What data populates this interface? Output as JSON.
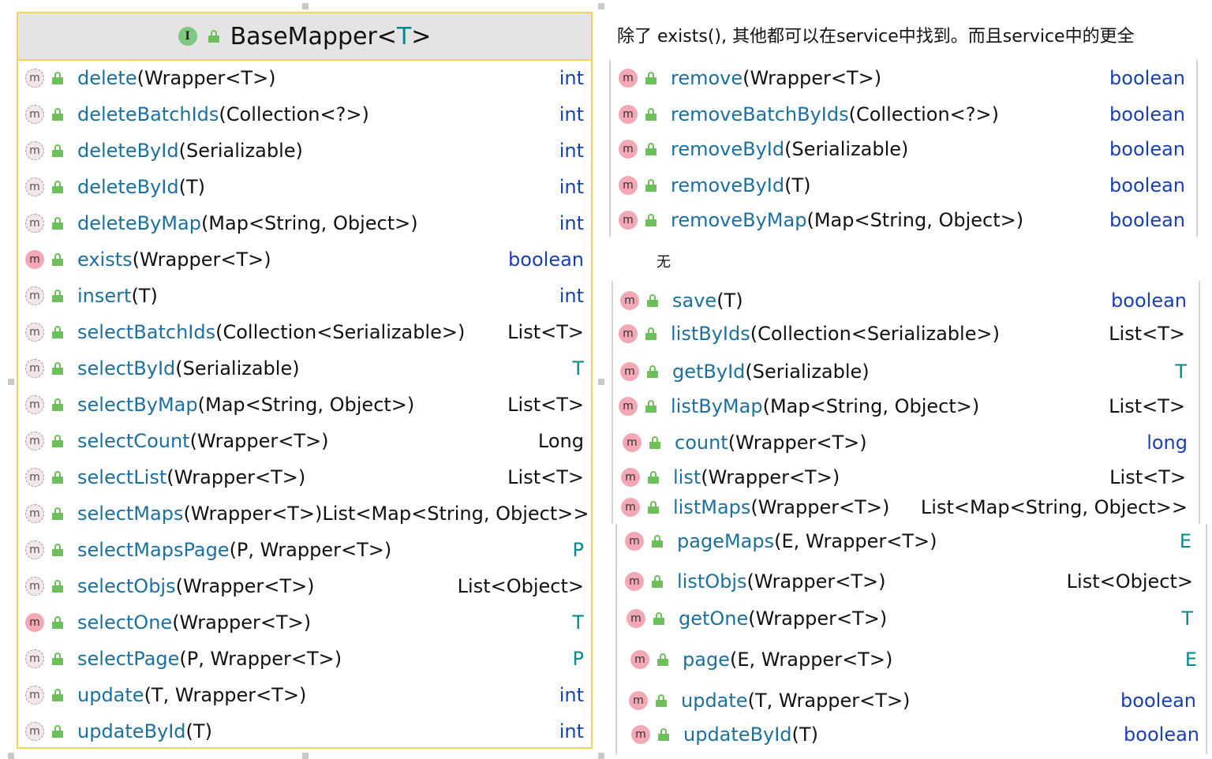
{
  "class": {
    "name": "BaseMapper",
    "type_param": "T",
    "iface_letter": "I"
  },
  "left_methods": [
    {
      "name": "delete",
      "params": "(Wrapper<T>)",
      "ret": "int",
      "style": "kw",
      "icon": "dim"
    },
    {
      "name": "deleteBatchIds",
      "params": "(Collection<?>)",
      "ret": "int",
      "style": "kw",
      "icon": "dim"
    },
    {
      "name": "deleteById",
      "params": "(Serializable)",
      "ret": "int",
      "style": "kw",
      "icon": "dim"
    },
    {
      "name": "deleteById",
      "params": "(T)",
      "ret": "int",
      "style": "kw",
      "icon": "dim"
    },
    {
      "name": "deleteByMap",
      "params": "(Map<String, Object>)",
      "ret": "int",
      "style": "kw",
      "icon": "dim"
    },
    {
      "name": "exists",
      "params": "(Wrapper<T>)",
      "ret": "boolean",
      "style": "kw",
      "icon": "full"
    },
    {
      "name": "insert",
      "params": "(T)",
      "ret": "int",
      "style": "kw",
      "icon": "dim"
    },
    {
      "name": "selectBatchIds",
      "params": "(Collection<Serializable>)",
      "ret": "List<T>",
      "style": "plain",
      "icon": "dim"
    },
    {
      "name": "selectById",
      "params": "(Serializable)",
      "ret": "T",
      "style": "tp",
      "icon": "dim"
    },
    {
      "name": "selectByMap",
      "params": "(Map<String, Object>)",
      "ret": "List<T>",
      "style": "plain",
      "icon": "dim"
    },
    {
      "name": "selectCount",
      "params": "(Wrapper<T>)",
      "ret": "Long",
      "style": "plain",
      "icon": "dim"
    },
    {
      "name": "selectList",
      "params": "(Wrapper<T>)",
      "ret": "List<T>",
      "style": "plain",
      "icon": "dim"
    },
    {
      "name": "selectMaps",
      "params": "(Wrapper<T>)",
      "ret": "List<Map<String, Object>>",
      "style": "plain",
      "icon": "dim"
    },
    {
      "name": "selectMapsPage",
      "params": "(P, Wrapper<T>)",
      "ret": "P",
      "style": "tp",
      "icon": "dim"
    },
    {
      "name": "selectObjs",
      "params": "(Wrapper<T>)",
      "ret": "List<Object>",
      "style": "plain",
      "icon": "dim"
    },
    {
      "name": "selectOne",
      "params": "(Wrapper<T>)",
      "ret": "T",
      "style": "tp",
      "icon": "full"
    },
    {
      "name": "selectPage",
      "params": "(P, Wrapper<T>)",
      "ret": "P",
      "style": "tp",
      "icon": "dim"
    },
    {
      "name": "update",
      "params": "(T, Wrapper<T>)",
      "ret": "int",
      "style": "kw",
      "icon": "dim"
    },
    {
      "name": "updateById",
      "params": "(T)",
      "ret": "int",
      "style": "kw",
      "icon": "dim"
    }
  ],
  "note": "除了 exists(), 其他都可以在service中找到。而且service中的更全",
  "none_label": "无",
  "right_methods": [
    {
      "name": "remove",
      "params": "(Wrapper<T>)",
      "ret": "boolean",
      "style": "kw"
    },
    {
      "name": "removeBatchByIds",
      "params": "(Collection<?>)",
      "ret": "boolean",
      "style": "kw"
    },
    {
      "name": "removeById",
      "params": "(Serializable)",
      "ret": "boolean",
      "style": "kw"
    },
    {
      "name": "removeById",
      "params": "(T)",
      "ret": "boolean",
      "style": "kw"
    },
    {
      "name": "removeByMap",
      "params": "(Map<String, Object>)",
      "ret": "boolean",
      "style": "kw"
    },
    {
      "name": "save",
      "params": "(T)",
      "ret": "boolean",
      "style": "kw"
    },
    {
      "name": "listByIds",
      "params": "(Collection<Serializable>)",
      "ret": "List<T>",
      "style": "plain"
    },
    {
      "name": "getById",
      "params": "(Serializable)",
      "ret": "T",
      "style": "tp"
    },
    {
      "name": "listByMap",
      "params": "(Map<String, Object>)",
      "ret": "List<T>",
      "style": "plain"
    },
    {
      "name": "count",
      "params": "(Wrapper<T>)",
      "ret": "long",
      "style": "kw"
    },
    {
      "name": "list",
      "params": "(Wrapper<T>)",
      "ret": "List<T>",
      "style": "plain"
    },
    {
      "name": "listMaps",
      "params": "(Wrapper<T>)",
      "ret": "List<Map<String, Object>>",
      "style": "plain"
    },
    {
      "name": "pageMaps",
      "params": "(E, Wrapper<T>)",
      "ret": "E",
      "style": "tp"
    },
    {
      "name": "listObjs",
      "params": "(Wrapper<T>)",
      "ret": "List<Object>",
      "style": "plain"
    },
    {
      "name": "getOne",
      "params": "(Wrapper<T>)",
      "ret": "T",
      "style": "tp"
    },
    {
      "name": "page",
      "params": "(E, Wrapper<T>)",
      "ret": "E",
      "style": "tp"
    },
    {
      "name": "update",
      "params": "(T, Wrapper<T>)",
      "ret": "boolean",
      "style": "kw"
    },
    {
      "name": "updateById",
      "params": "(T)",
      "ret": "boolean",
      "style": "kw"
    }
  ],
  "icon_letter": "m"
}
